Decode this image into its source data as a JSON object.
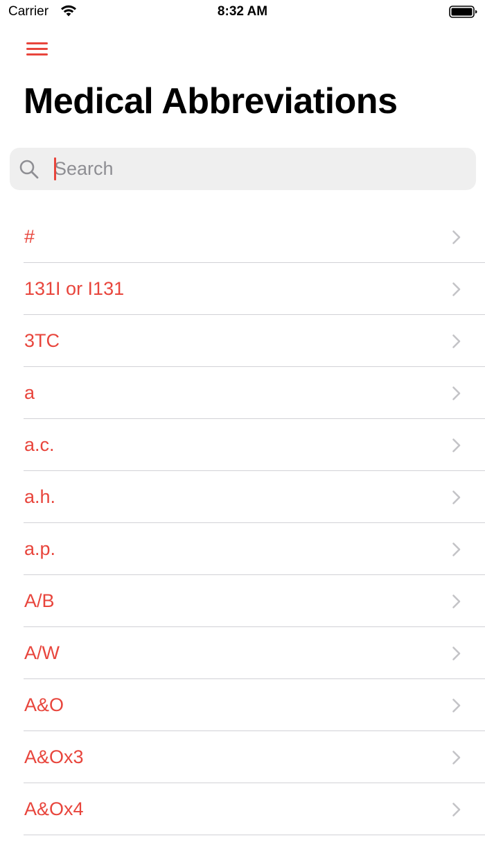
{
  "status_bar": {
    "carrier": "Carrier",
    "time": "8:32 AM"
  },
  "nav": {
    "menu_icon": "hamburger-menu-icon",
    "title": "Medical Abbreviations"
  },
  "search": {
    "placeholder": "Search",
    "value": ""
  },
  "colors": {
    "accent": "#e8453c",
    "search_background": "#efefef",
    "separator": "#d1d1d6",
    "chevron": "#c4c4c7"
  },
  "list": {
    "items": [
      {
        "label": "#"
      },
      {
        "label": "131I or I131"
      },
      {
        "label": "3TC"
      },
      {
        "label": "a"
      },
      {
        "label": "a.c."
      },
      {
        "label": "a.h."
      },
      {
        "label": "a.p."
      },
      {
        "label": "A/B"
      },
      {
        "label": "A/W"
      },
      {
        "label": "A&O"
      },
      {
        "label": "A&Ox3"
      },
      {
        "label": "A&Ox4"
      }
    ]
  }
}
